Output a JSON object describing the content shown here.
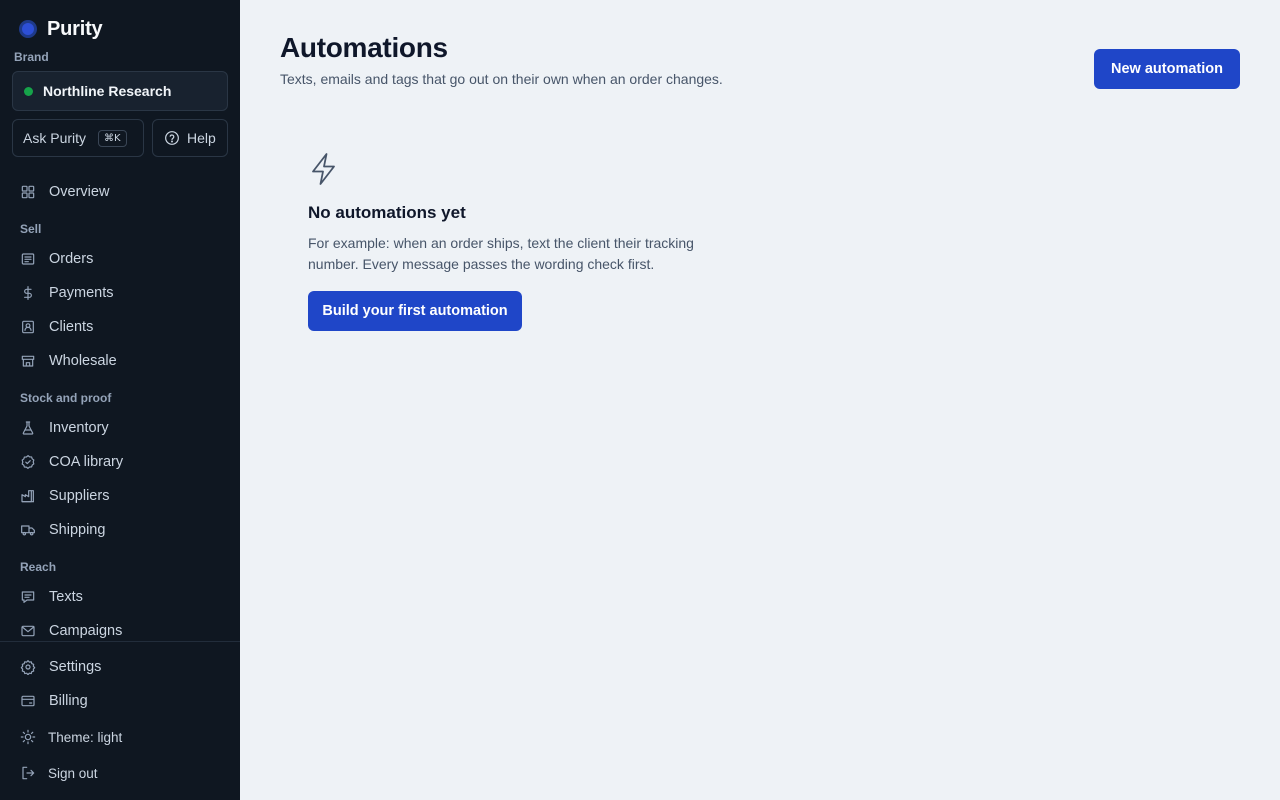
{
  "sidebar": {
    "logo": "Purity",
    "brand_label": "Brand",
    "brand_name": "Northline Research",
    "ask_label": "Ask Purity",
    "ask_shortcut": "⌘K",
    "help_label": "Help",
    "overview": "Overview",
    "sections": {
      "sell": "Sell",
      "stock": "Stock and proof",
      "reach": "Reach"
    },
    "items": {
      "orders": "Orders",
      "payments": "Payments",
      "clients": "Clients",
      "wholesale": "Wholesale",
      "inventory": "Inventory",
      "coa": "COA library",
      "suppliers": "Suppliers",
      "shipping": "Shipping",
      "texts": "Texts",
      "campaigns": "Campaigns",
      "settings": "Settings",
      "billing": "Billing",
      "theme": "Theme: light",
      "signout": "Sign out"
    }
  },
  "main": {
    "title": "Automations",
    "subtitle": "Texts, emails and tags that go out on their own when an order changes.",
    "new_button": "New automation",
    "empty": {
      "title": "No automations yet",
      "description": "For example: when an order ships, text the client their tracking number. Every message passes the wording check first.",
      "button": "Build your first automation"
    }
  },
  "colors": {
    "sidebar_bg": "#0f1721",
    "main_bg": "#eef2f6",
    "accent": "#1f46c8",
    "status_green": "#16a34a"
  },
  "icons": [
    "grid-icon",
    "receipt-icon",
    "dollar-icon",
    "contact-icon",
    "storefront-icon",
    "flask-icon",
    "badge-check-icon",
    "factory-icon",
    "truck-icon",
    "message-icon",
    "mail-icon",
    "gear-icon",
    "card-icon",
    "sun-icon",
    "logout-icon",
    "bolt-icon",
    "help-circle-icon"
  ]
}
